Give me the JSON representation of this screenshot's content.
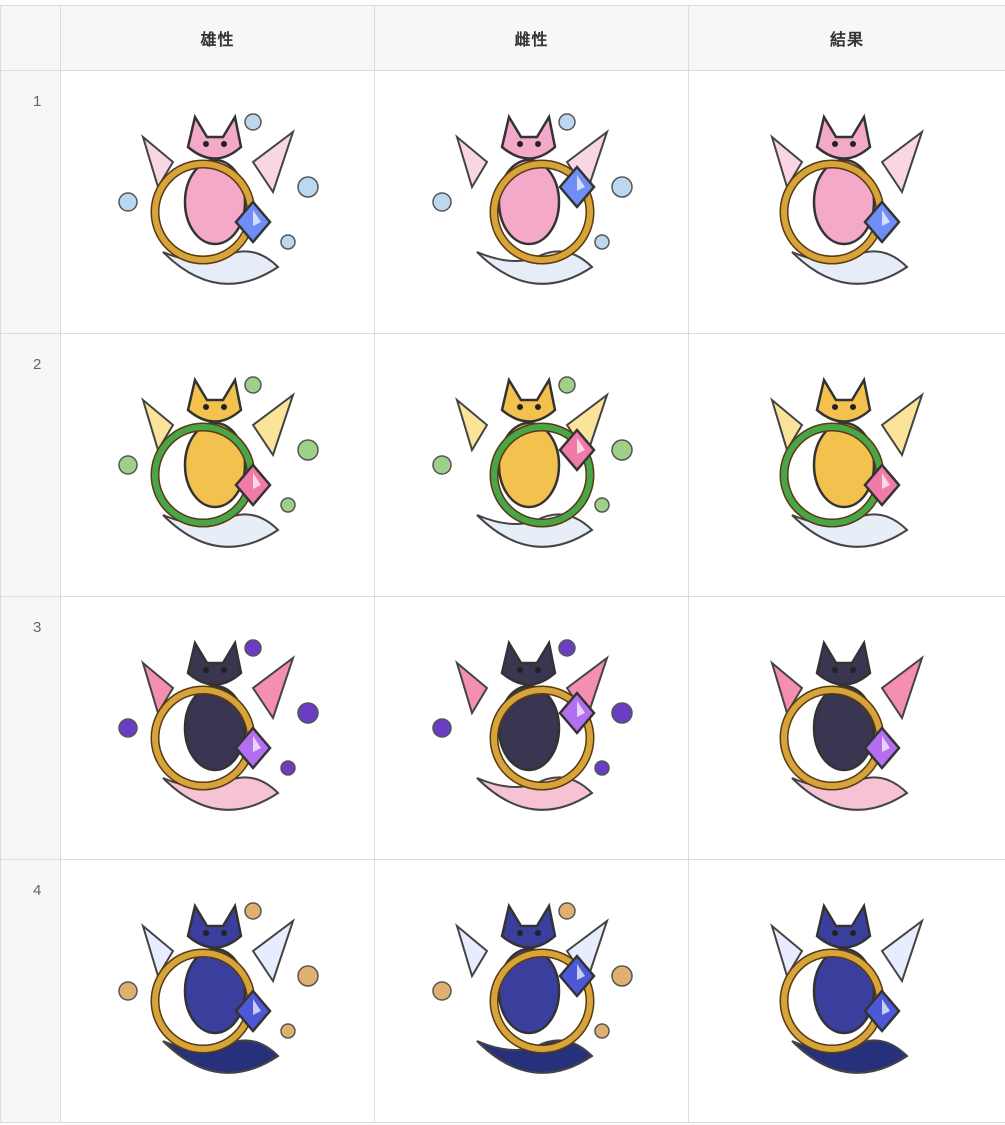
{
  "table": {
    "headers": [
      "",
      "雄性",
      "雌性",
      "結果"
    ],
    "rows": [
      {
        "index": "1",
        "theme": {
          "body": "#f4a9c8",
          "accent": "#f9d6e4",
          "ring": "#d6a43a",
          "gem": "#6f8ef5",
          "deco": "#bcd8f0",
          "tail": "#e6ecf8"
        }
      },
      {
        "index": "2",
        "theme": {
          "body": "#f2c14e",
          "accent": "#fbe39a",
          "ring": "#4aa54a",
          "gem": "#f07aa8",
          "deco": "#9fd08a",
          "tail": "#e8eef8"
        }
      },
      {
        "index": "3",
        "theme": {
          "body": "#3a3550",
          "accent": "#f48fb1",
          "ring": "#d6a43a",
          "gem": "#b36ef2",
          "deco": "#6b3cc4",
          "tail": "#f6c3d4"
        }
      },
      {
        "index": "4",
        "theme": {
          "body": "#3a3f9e",
          "accent": "#e8ecff",
          "ring": "#d6a43a",
          "gem": "#4d58d6",
          "deco": "#e0b070",
          "tail": "#27307a"
        }
      }
    ]
  },
  "icons": {
    "male": "fox-creature-male-icon",
    "female": "fox-creature-female-icon",
    "result": "fox-creature-result-icon"
  }
}
